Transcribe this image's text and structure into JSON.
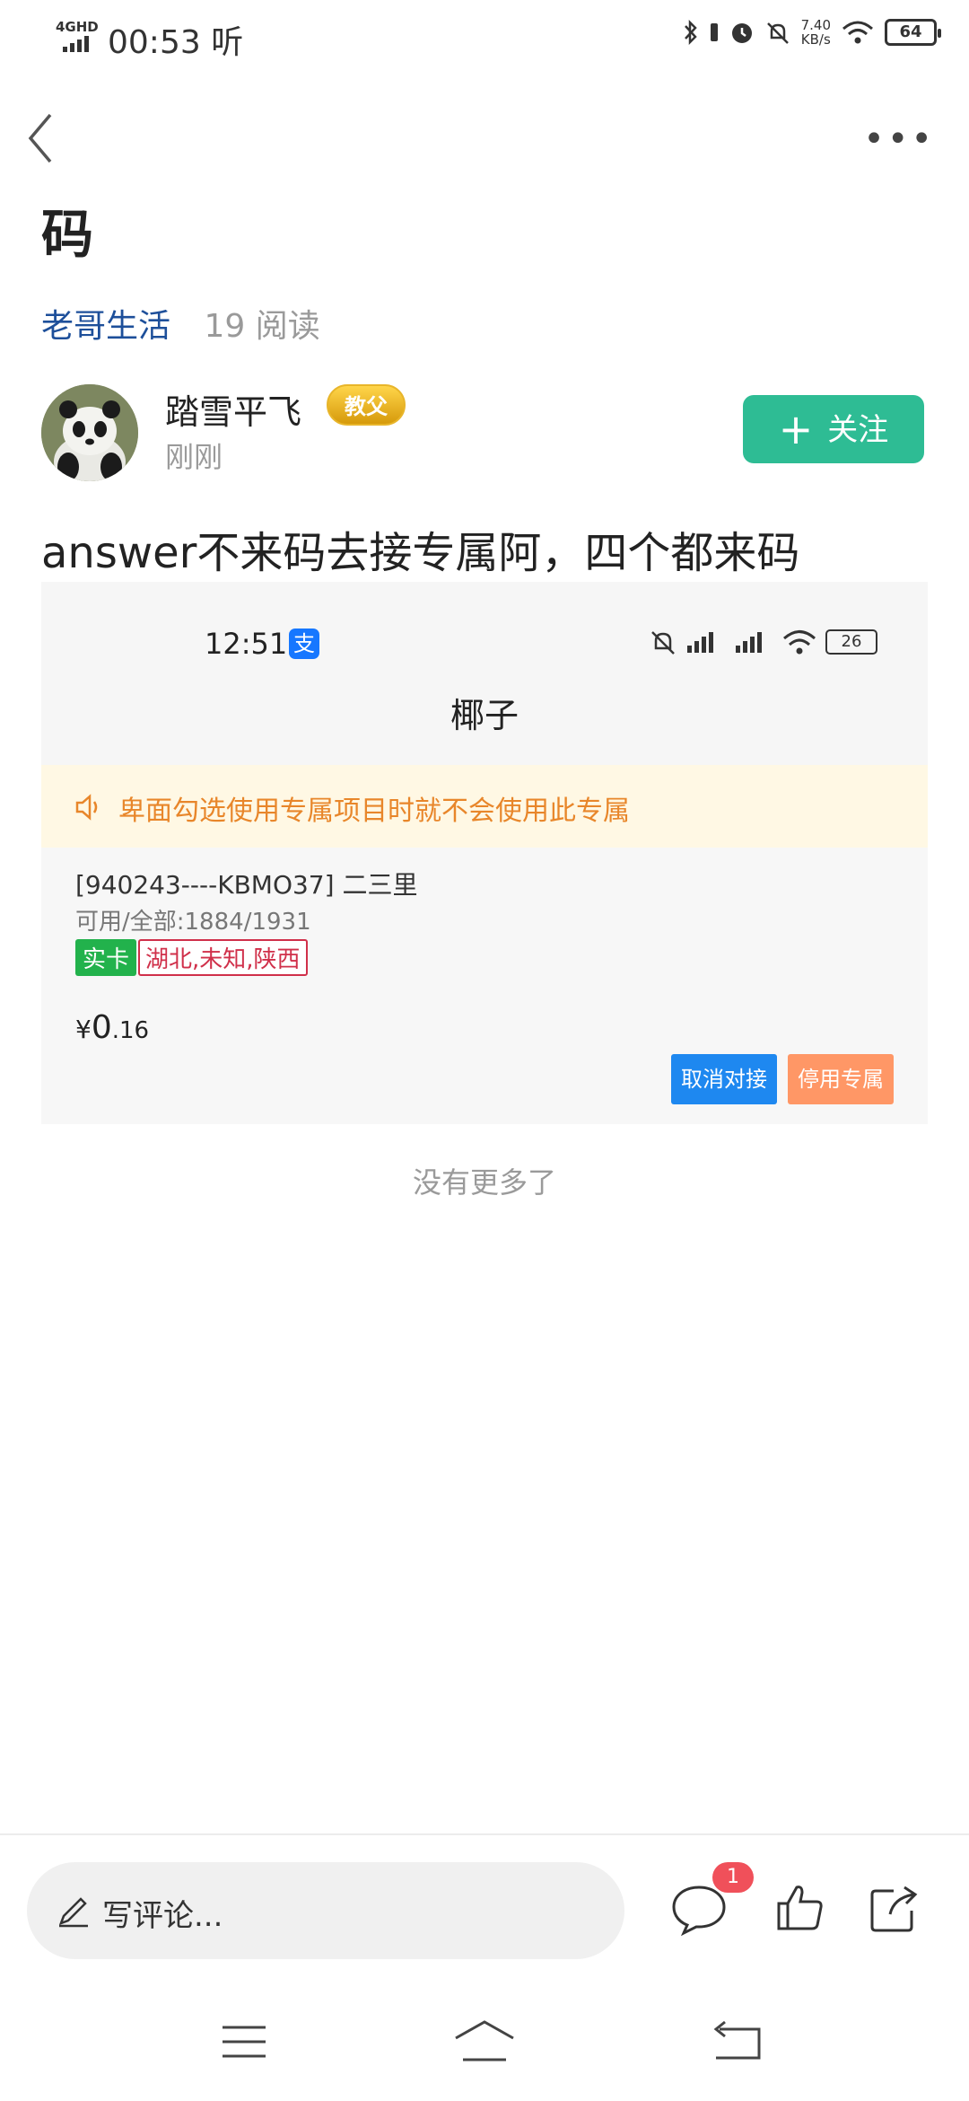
{
  "status_bar": {
    "network": "4GHD",
    "time": "00:53",
    "carrier_glyph": "听",
    "speed_value": "7.40",
    "speed_unit": "KB/s",
    "battery": "64"
  },
  "nav": {
    "back_icon": "chevron-left-icon",
    "more_icon": "more-dots-icon"
  },
  "post": {
    "title": "码",
    "channel": "老哥生活",
    "reads": "19 阅读",
    "text": "answer不来码去接专属阿，四个都来码"
  },
  "author": {
    "name": "踏雪平飞",
    "badge": "教父",
    "time": "刚刚",
    "follow_label": "关注"
  },
  "embedded": {
    "time": "12:51",
    "alipay_glyph": "支",
    "battery": "26",
    "header": "椰子",
    "notice": "卑面勾选使用专属项目时就不会使用此专属",
    "item_line1": "[940243----KBMO37] 二三里",
    "item_line2": "可用/全部:1884/1931",
    "tag_green": "实卡",
    "tag_red": "湖北,未知,陕西",
    "price_symbol": "¥",
    "price_int": "0",
    "price_dec": ".16",
    "btn_cancel": "取消对接",
    "btn_disable": "停用专属",
    "colors": {
      "primary_button": "#1e88f0",
      "secondary_button": "#ff9766",
      "notice_text": "#e8862a"
    }
  },
  "no_more": "没有更多了",
  "bottom_bar": {
    "comment_placeholder": "写评论...",
    "comment_count": "1"
  },
  "colors": {
    "follow": "#2ebc94",
    "channel": "#1d4f9a",
    "badge_red": "#f0505a"
  }
}
